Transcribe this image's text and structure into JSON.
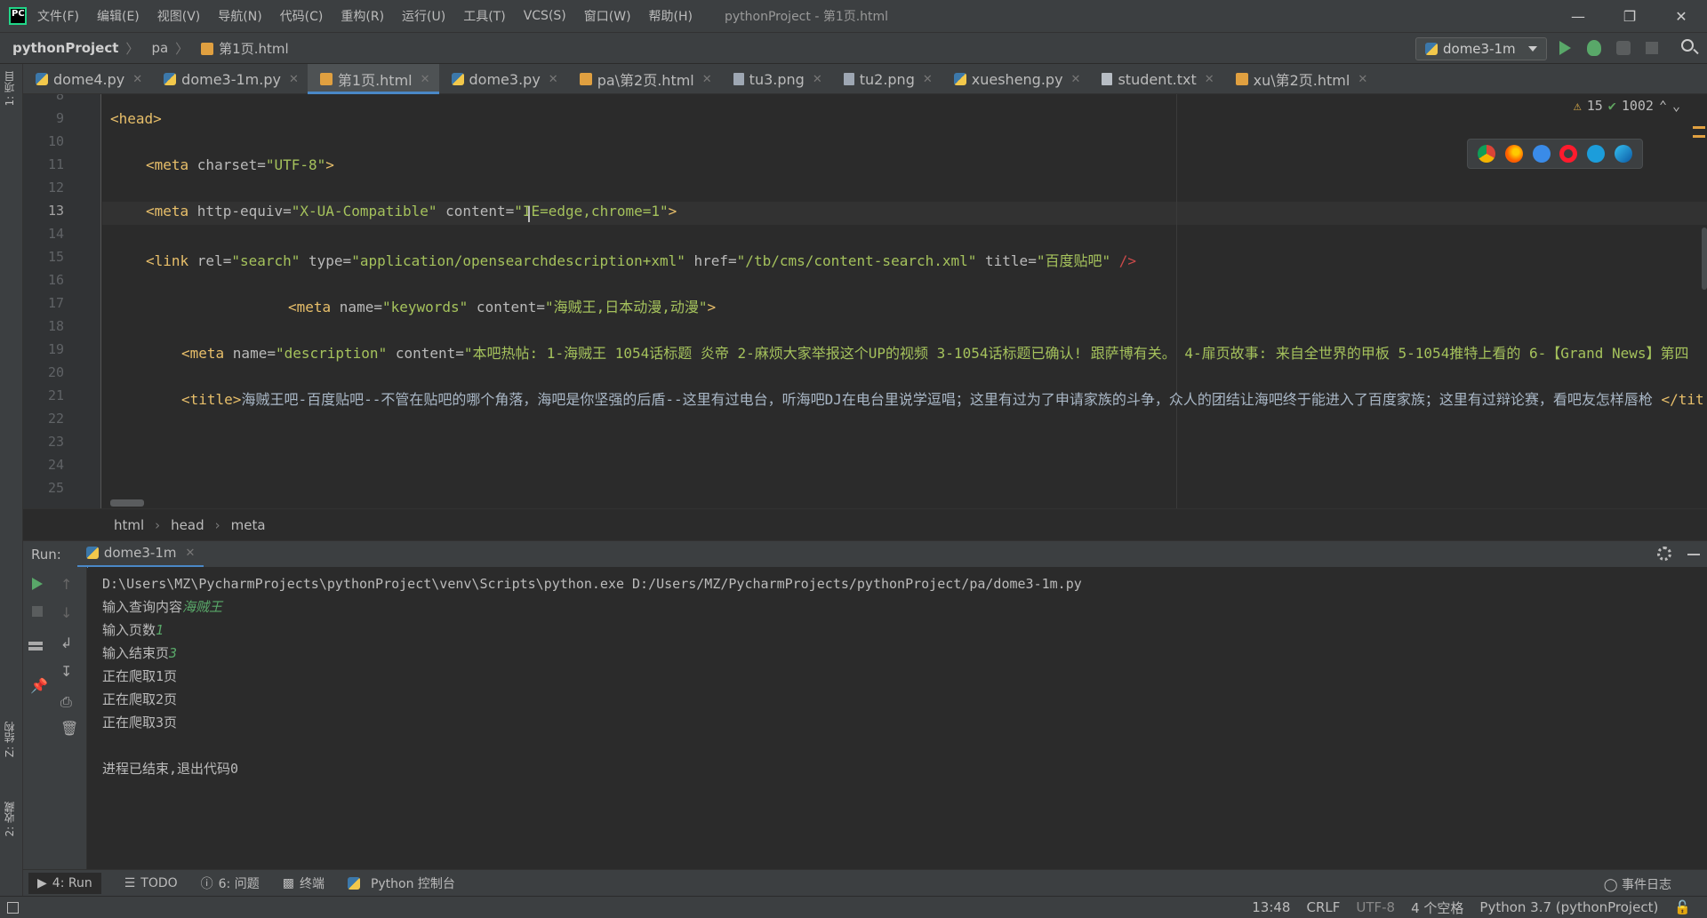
{
  "menu": {
    "items": [
      "文件(F)",
      "编辑(E)",
      "视图(V)",
      "导航(N)",
      "代码(C)",
      "重构(R)",
      "运行(U)",
      "工具(T)",
      "VCS(S)",
      "窗口(W)",
      "帮助(H)"
    ],
    "title": "pythonProject - 第1页.html"
  },
  "nav": {
    "project": "pythonProject",
    "folder": "pa",
    "file": "第1页.html",
    "run_config": "dome3-1m"
  },
  "left_strip": {
    "project_tab": "1: 项目",
    "structure_tab": "Z: 结构",
    "favorites_tab": "2: 收藏"
  },
  "tabs": [
    {
      "label": "dome4.py",
      "icon": "python-file-icon"
    },
    {
      "label": "dome3-1m.py",
      "icon": "python-file-icon"
    },
    {
      "label": "第1页.html",
      "icon": "html-file-icon",
      "active": true
    },
    {
      "label": "dome3.py",
      "icon": "python-file-icon"
    },
    {
      "label": "pa\\第2页.html",
      "icon": "html-file-icon"
    },
    {
      "label": "tu3.png",
      "icon": "image-file-icon"
    },
    {
      "label": "tu2.png",
      "icon": "image-file-icon"
    },
    {
      "label": "xuesheng.py",
      "icon": "python-file-icon"
    },
    {
      "label": "student.txt",
      "icon": "text-file-icon"
    },
    {
      "label": "xu\\第2页.html",
      "icon": "html-file-icon"
    }
  ],
  "editor": {
    "line_numbers": [
      "8",
      "9",
      "10",
      "11",
      "12",
      "13",
      "14",
      "15",
      "16",
      "17",
      "18",
      "19",
      "20",
      "21",
      "22",
      "23",
      "24",
      "25"
    ],
    "current_line": "13",
    "warnings": "15",
    "ok_count": "1002",
    "lines": {
      "l9_tag": "<head>",
      "l11_tag_open": "<meta ",
      "l11_attr": "charset=",
      "l11_val": "\"UTF-8\"",
      "l11_close": ">",
      "l13_tag_open": "<meta ",
      "l13_attr1": "http-equiv=",
      "l13_val1": "\"X-UA-Compatible\"",
      "l13_attr2": " content=",
      "l13_val2": "\"IE=edge,chrome=1\"",
      "l13_close": ">",
      "l15_tag_open": "<link ",
      "l15_attr1": "rel=",
      "l15_val1": "\"search\"",
      "l15_attr2": " type=",
      "l15_val2": "\"application/opensearchdescription+xml\"",
      "l15_attr3": " href=",
      "l15_val3": "\"/tb/cms/content-search.xml\"",
      "l15_attr4": " title=",
      "l15_val4": "\"百度贴吧\"",
      "l15_close": " />",
      "l17_tag_open": "<meta ",
      "l17_attr1": "name=",
      "l17_val1": "\"keywords\"",
      "l17_attr2": " content=",
      "l17_val2": "\"海贼王,日本动漫,动漫\"",
      "l17_close": ">",
      "l19_tag_open": "<meta ",
      "l19_attr1": "name=",
      "l19_val1": "\"description\"",
      "l19_attr2": " content=",
      "l19_val2": "\"本吧热帖: 1-海贼王 1054话标题 炎帝 2-麻烦大家举报这个UP的视频 3-1054话标题已确认! 跟萨博有关。 4-扉页故事: 来自全世界的甲板 5-1054推特上看的 6-【Grand News】第四",
      "l21_tag_open": "<title>",
      "l21_text": "海贼王吧-百度贴吧--不管在贴吧的哪个角落，海吧是你坚强的后盾--这里有过电台，听海吧DJ在电台里说学逗唱；这里有过为了申请家族的斗争，众人的团结让海吧终于能进入了百度家族；这里有过辩论赛，看吧友怎样唇枪 ",
      "l21_tag_close": "</tit"
    }
  },
  "editor_breadcrumb": [
    "html",
    "head",
    "meta"
  ],
  "run": {
    "label": "Run:",
    "tab": "dome3-1m",
    "console": {
      "command": "D:\\Users\\MZ\\PycharmProjects\\pythonProject\\venv\\Scripts\\python.exe D:/Users/MZ/PycharmProjects/pythonProject/pa/dome3-1m.py",
      "prompt1": "输入查询内容",
      "input1": "海贼王",
      "prompt2": "输入页数",
      "input2": "1",
      "prompt3": "输入结束页",
      "input3": "3",
      "out1": "正在爬取1页",
      "out2": "正在爬取2页",
      "out3": "正在爬取3页",
      "exit": "进程已结束,退出代码0"
    }
  },
  "bottom_tabs": {
    "run": "4: Run",
    "todo": "TODO",
    "problems": "6: 问题",
    "terminal": "终端",
    "python_console": "Python 控制台",
    "event_log": "事件日志"
  },
  "status": {
    "position": "13:48",
    "line_sep": "CRLF",
    "encoding": "UTF-8",
    "indent": "4 个空格",
    "interpreter": "Python 3.7 (pythonProject)"
  },
  "colors": {
    "accent": "#4a88c7",
    "run_green": "#59a869",
    "tag": "#e8bf6a",
    "string": "#a5c25c"
  }
}
